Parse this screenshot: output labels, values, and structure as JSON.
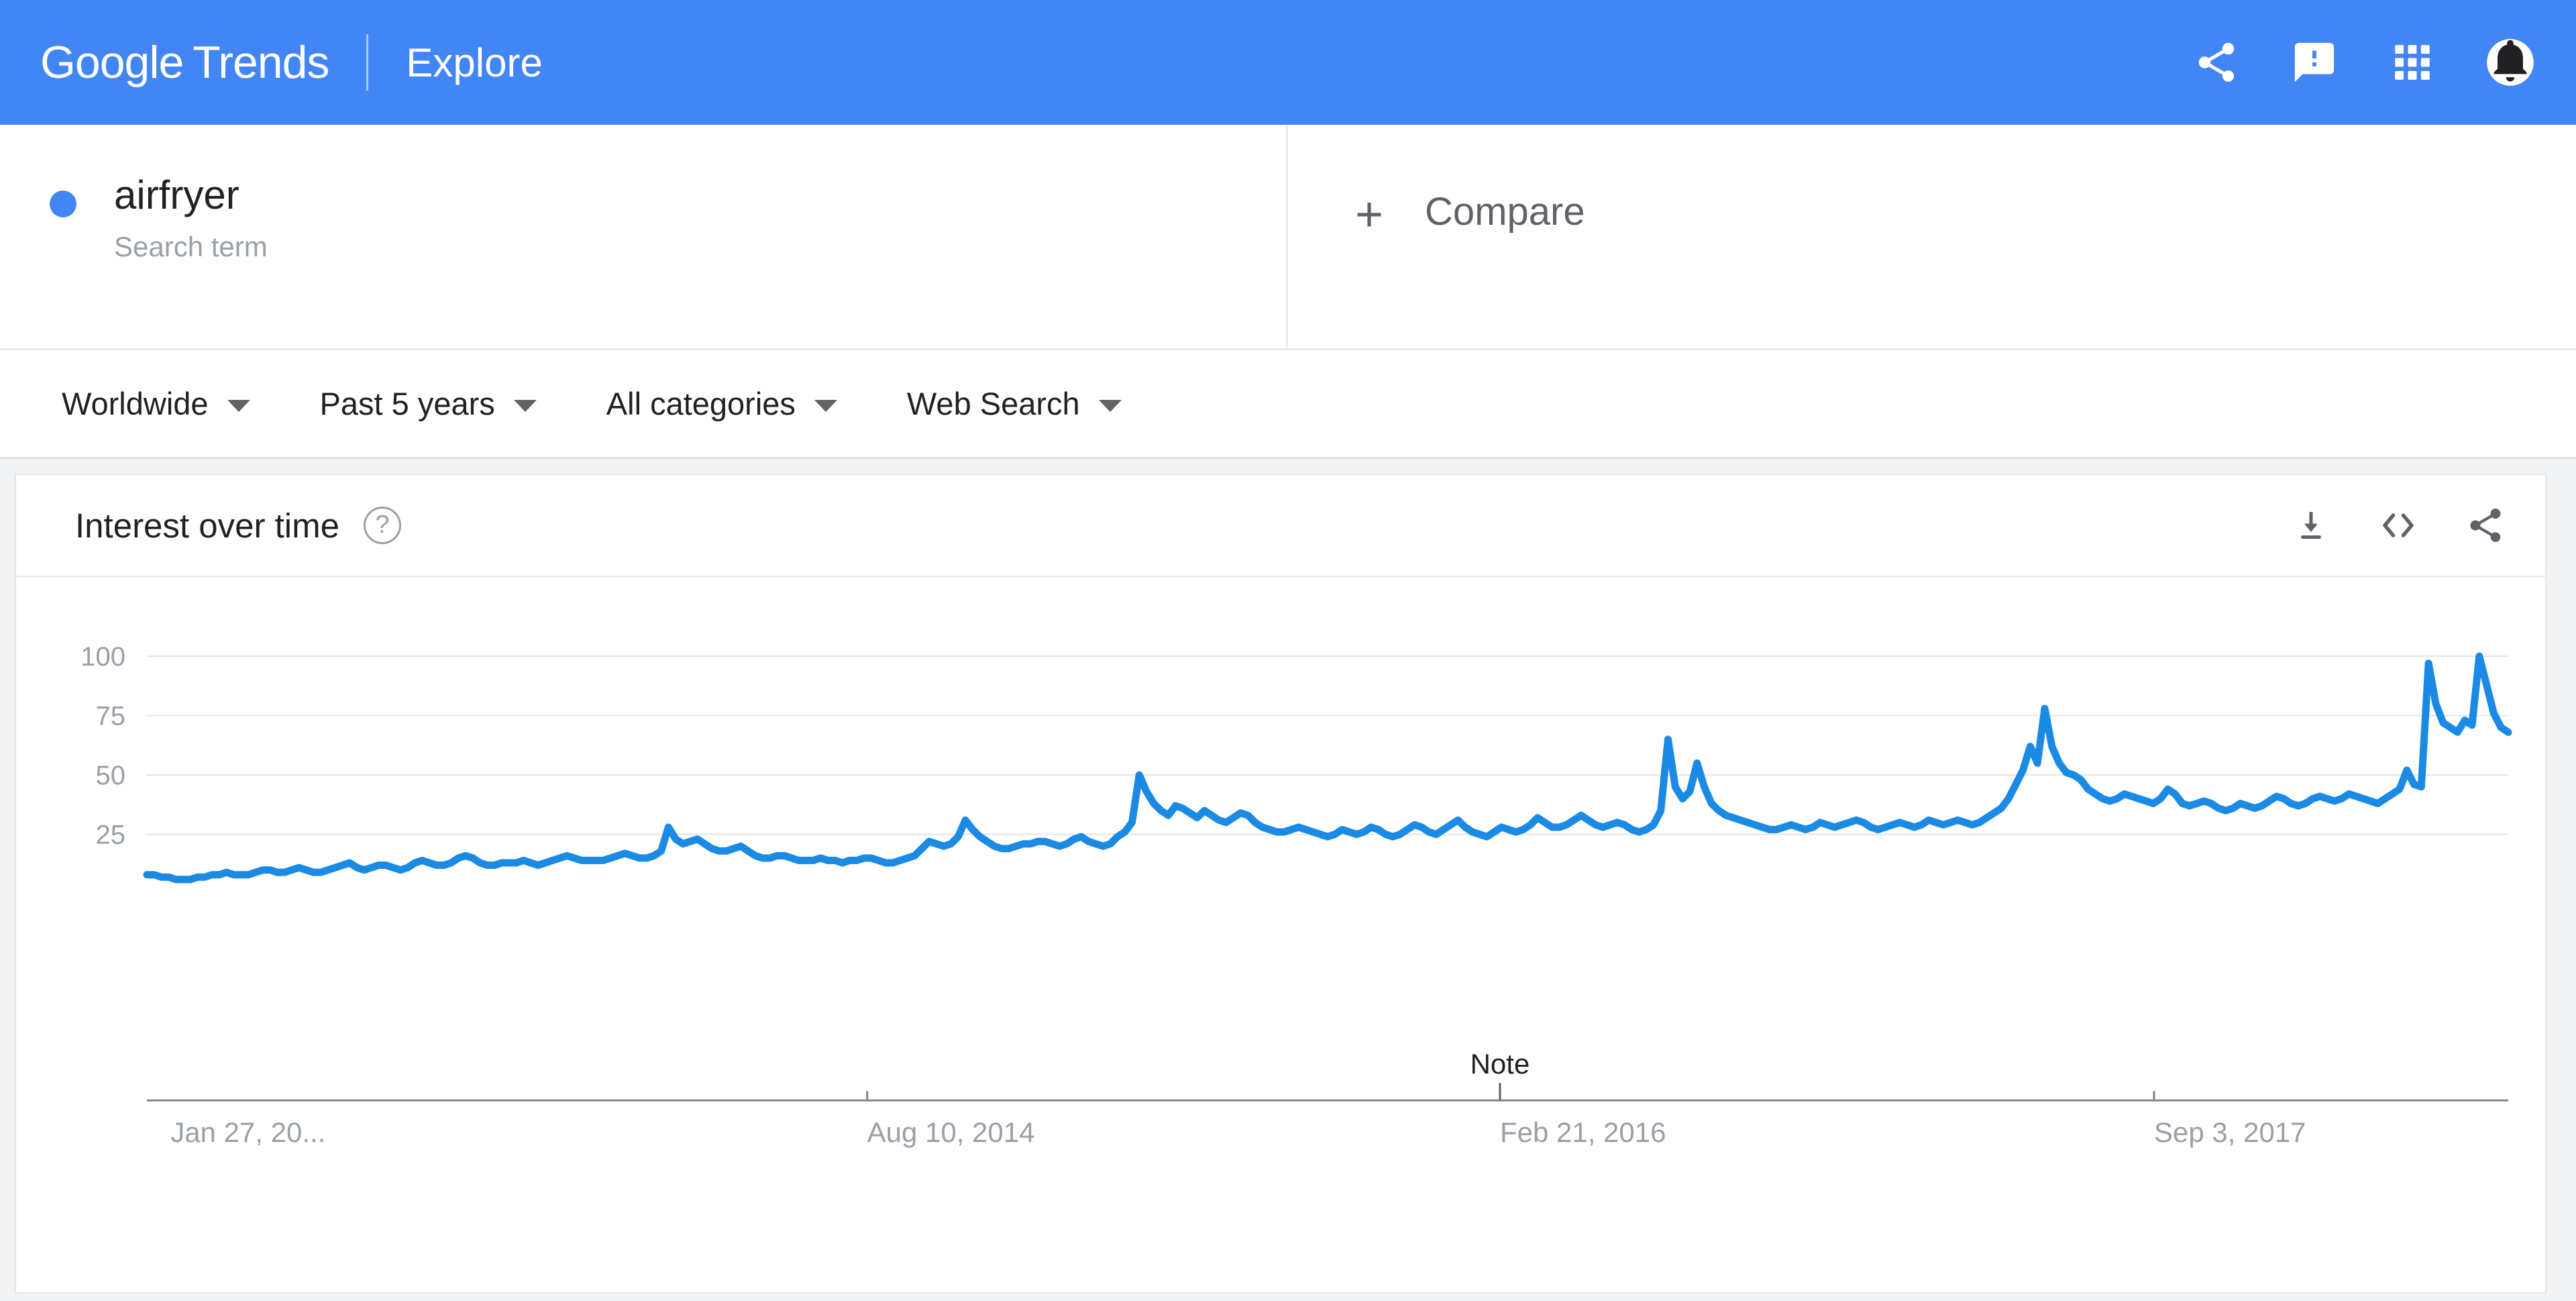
{
  "header": {
    "brand_google": "Google",
    "brand_trends": "Trends",
    "explore_label": "Explore",
    "icons": [
      "share-icon",
      "feedback-icon",
      "apps-grid-icon",
      "notifications-avatar-icon"
    ],
    "background_color": "#4285f4"
  },
  "query": {
    "term": "airfryer",
    "term_type": "Search term",
    "dot_color": "#4285f4",
    "compare_plus": "+",
    "compare_label": "Compare"
  },
  "filters": [
    {
      "label": "Worldwide",
      "name": "location-filter"
    },
    {
      "label": "Past 5 years",
      "name": "time-range-filter"
    },
    {
      "label": "All categories",
      "name": "category-filter"
    },
    {
      "label": "Web Search",
      "name": "search-type-filter"
    }
  ],
  "card": {
    "title": "Interest over time",
    "help_glyph": "?",
    "actions": [
      "download-icon",
      "embed-icon",
      "share-icon"
    ]
  },
  "chart_data": {
    "type": "line",
    "title": "Interest over time",
    "xlabel": "",
    "ylabel": "",
    "ylim": [
      0,
      100
    ],
    "yticks": [
      25,
      50,
      75,
      100
    ],
    "ytick_labels": [
      "25",
      "50",
      "75",
      "100"
    ],
    "grid": true,
    "legend": false,
    "line_color": "#1a8ae5",
    "axis_color": "#9aa0a6",
    "gridline_color": "#e4e6e8",
    "xtick_labels": [
      "Jan 27, 20...",
      "Aug 10, 2014",
      "Feb 21, 2016",
      "Sep 3, 2017"
    ],
    "xtick_positions_pct": [
      1.0,
      30.5,
      57.3,
      85.0
    ],
    "annotations": [
      {
        "label": "Note",
        "x_pct": 57.3
      }
    ],
    "series": [
      {
        "name": "airfryer",
        "color": "#1a8ae5",
        "values": [
          8,
          8,
          7,
          7,
          6,
          6,
          6,
          7,
          7,
          8,
          8,
          9,
          8,
          8,
          8,
          9,
          10,
          10,
          9,
          9,
          10,
          11,
          10,
          9,
          9,
          10,
          11,
          12,
          13,
          11,
          10,
          11,
          12,
          12,
          11,
          10,
          11,
          13,
          14,
          13,
          12,
          12,
          13,
          15,
          16,
          15,
          13,
          12,
          12,
          13,
          13,
          13,
          14,
          13,
          12,
          13,
          14,
          15,
          16,
          15,
          14,
          14,
          14,
          14,
          15,
          16,
          17,
          16,
          15,
          15,
          16,
          18,
          28,
          23,
          21,
          22,
          23,
          21,
          19,
          18,
          18,
          19,
          20,
          18,
          16,
          15,
          15,
          16,
          16,
          15,
          14,
          14,
          14,
          15,
          14,
          14,
          13,
          14,
          14,
          15,
          15,
          14,
          13,
          13,
          14,
          15,
          16,
          19,
          22,
          21,
          20,
          21,
          24,
          31,
          27,
          24,
          22,
          20,
          19,
          19,
          20,
          21,
          21,
          22,
          22,
          21,
          20,
          21,
          23,
          24,
          22,
          21,
          20,
          21,
          24,
          26,
          30,
          50,
          43,
          38,
          35,
          33,
          37,
          36,
          34,
          32,
          35,
          33,
          31,
          30,
          32,
          34,
          33,
          30,
          28,
          27,
          26,
          26,
          27,
          28,
          27,
          26,
          25,
          24,
          25,
          27,
          26,
          25,
          26,
          28,
          27,
          25,
          24,
          25,
          27,
          29,
          28,
          26,
          25,
          27,
          29,
          31,
          28,
          26,
          25,
          24,
          26,
          28,
          27,
          26,
          27,
          29,
          32,
          30,
          28,
          28,
          29,
          31,
          33,
          31,
          29,
          28,
          29,
          30,
          29,
          27,
          26,
          27,
          29,
          35,
          65,
          45,
          40,
          43,
          55,
          45,
          38,
          35,
          33,
          32,
          31,
          30,
          29,
          28,
          27,
          27,
          28,
          29,
          28,
          27,
          28,
          30,
          29,
          28,
          29,
          30,
          31,
          30,
          28,
          27,
          28,
          29,
          30,
          29,
          28,
          29,
          31,
          30,
          29,
          30,
          31,
          30,
          29,
          30,
          32,
          34,
          36,
          40,
          46,
          52,
          62,
          55,
          78,
          62,
          55,
          51,
          50,
          48,
          44,
          42,
          40,
          39,
          40,
          42,
          41,
          40,
          39,
          38,
          40,
          44,
          42,
          38,
          37,
          38,
          39,
          38,
          36,
          35,
          36,
          38,
          37,
          36,
          37,
          39,
          41,
          40,
          38,
          37,
          38,
          40,
          41,
          40,
          39,
          40,
          42,
          41,
          40,
          39,
          38,
          40,
          42,
          44,
          52,
          46,
          45,
          97,
          80,
          72,
          70,
          68,
          73,
          71,
          100,
          88,
          76,
          70,
          68
        ]
      }
    ]
  }
}
